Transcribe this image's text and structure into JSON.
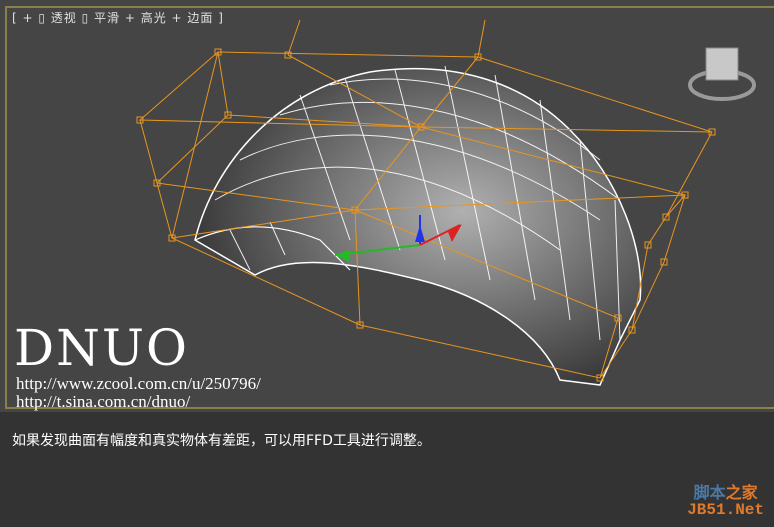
{
  "viewport": {
    "label": "[ + ▯ 透视 ▯ 平滑 + 高光 + 边面 ]",
    "colors": {
      "lattice": "#e8951e",
      "mesh": "#ffffff",
      "frame": "#8a7f45",
      "background": "#454545"
    }
  },
  "watermark": {
    "title": "DNUO",
    "url1": "http://www.zcool.com.cn/u/250796/",
    "url2": "http://t.sina.com.cn/dnuo/"
  },
  "caption": "如果发现曲面有幅度和真实物体有差距，可以用FFD工具进行调整。",
  "site_logo": {
    "line1_a": "脚本",
    "line1_b": "之家",
    "line2": "JB51.Net"
  }
}
